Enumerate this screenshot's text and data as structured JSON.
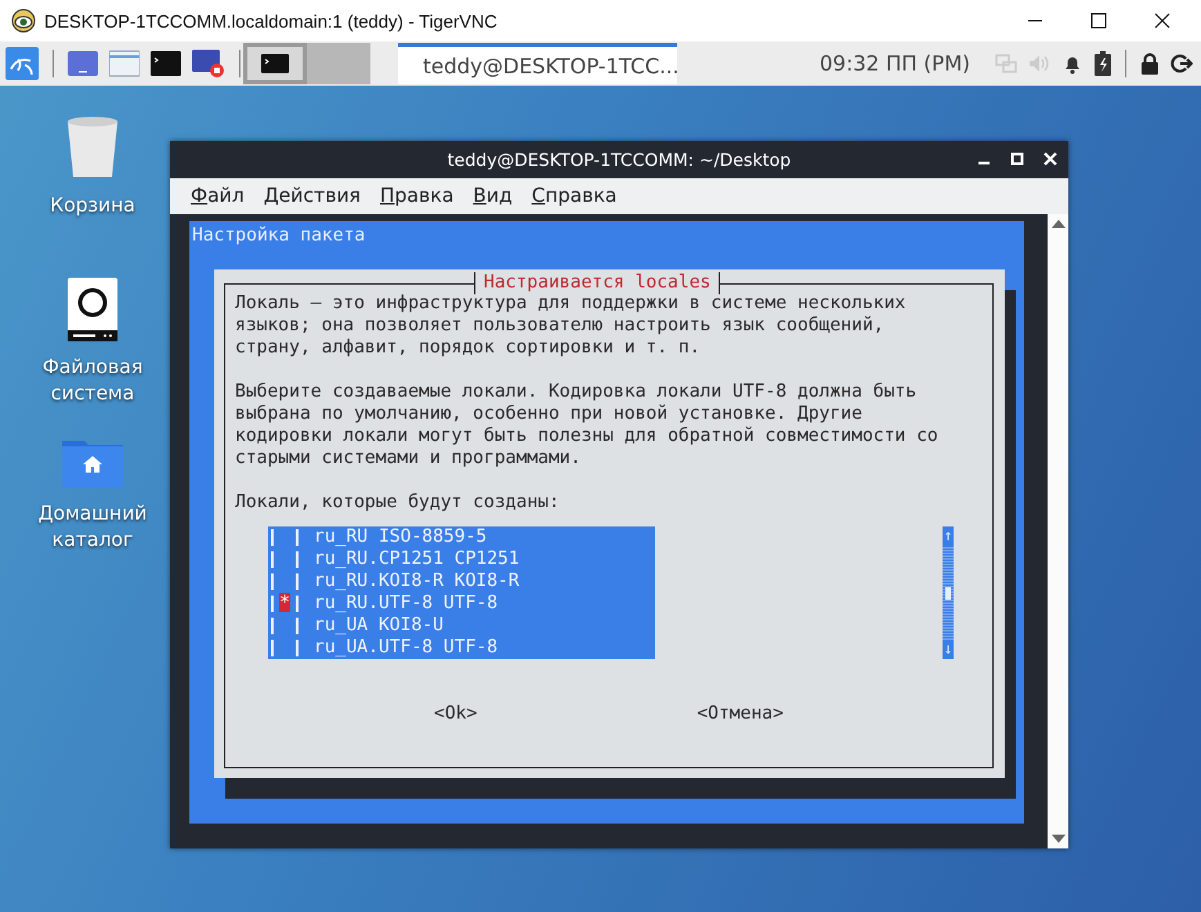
{
  "vnc_window": {
    "title": "DESKTOP-1TCCOMM.localdomain:1 (teddy) - TigerVNC"
  },
  "taskbar": {
    "workspaces": [
      {
        "selected": true
      },
      {
        "selected": false
      }
    ],
    "tasks": [
      {
        "label": "teddy@DESKTOP-1TCC...",
        "selected": true
      }
    ],
    "clock": "09:32 ПП (PM)"
  },
  "desktop_icons": [
    {
      "kind": "trash",
      "label": "Корзина"
    },
    {
      "kind": "drive",
      "label": "Файловая система"
    },
    {
      "kind": "home",
      "label": "Домашний каталог"
    }
  ],
  "terminal": {
    "title": "teddy@DESKTOP-1TCCOMM: ~/Desktop",
    "menu": [
      "Файл",
      "Действия",
      "Правка",
      "Вид",
      "Справка"
    ],
    "backtitle": "Настройка пакета",
    "dialog": {
      "title": "Настраивается locales",
      "paragraphs": [
        "Локаль — это инфраструктура для поддержки в системе нескольких\nязыков; она позволяет пользователю настроить язык сообщений,\nстрану, алфавит, порядок сортировки и т. п.",
        "Выберите создаваемые локали. Кодировка локали UTF-8 должна быть\nвыбрана по умолчанию, особенно при новой установке. Другие\nкодировки локали могут быть полезны для обратной совместимости со\nстарыми системами и программами.",
        "Локали, которые будут созданы:"
      ],
      "check_symbol": "*",
      "locales": [
        {
          "label": "ru_RU ISO-8859-5",
          "checked": false
        },
        {
          "label": "ru_RU.CP1251 CP1251",
          "checked": false
        },
        {
          "label": "ru_RU.KOI8-R KOI8-R",
          "checked": false
        },
        {
          "label": "ru_RU.UTF-8 UTF-8",
          "checked": true
        },
        {
          "label": "ru_UA KOI8-U",
          "checked": false
        },
        {
          "label": "ru_UA.UTF-8 UTF-8",
          "checked": false
        }
      ],
      "scroll_up": "↑",
      "scroll_down": "↓",
      "buttons": [
        "<Ok>",
        "<Отмена>"
      ]
    }
  }
}
